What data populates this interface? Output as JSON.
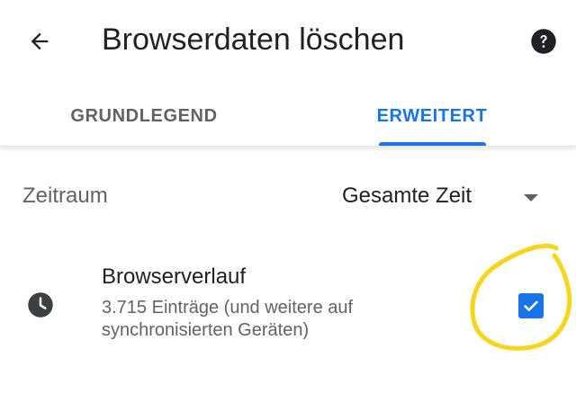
{
  "header": {
    "title": "Browserdaten löschen",
    "back_icon": "arrow-back-icon",
    "help_icon": "help-circle-icon"
  },
  "tabs": [
    {
      "label": "GRUNDLEGEND",
      "selected": false
    },
    {
      "label": "ERWEITERT",
      "selected": true
    }
  ],
  "time_range": {
    "label": "Zeitraum",
    "value": "Gesamte Zeit"
  },
  "items": [
    {
      "icon": "clock-icon",
      "title": "Browserverlauf",
      "description": "3.715 Einträge (und weitere auf synchronisierten Geräten)",
      "checked": true
    }
  ],
  "colors": {
    "accent": "#1a73e8",
    "highlight_annotation": "#f7d51d",
    "text_primary": "#202124",
    "text_secondary": "#5f6368"
  }
}
